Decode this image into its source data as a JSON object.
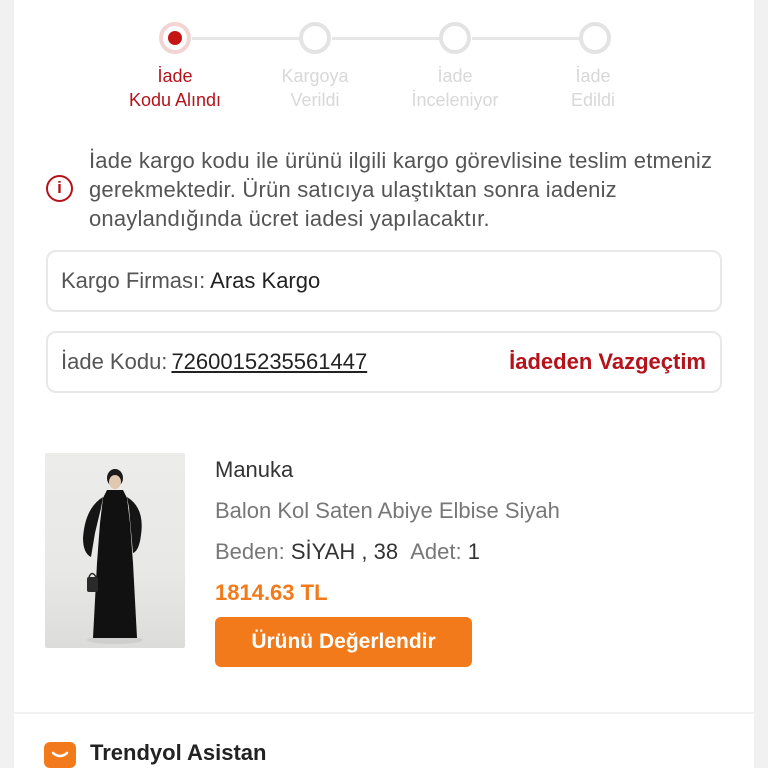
{
  "stepper": {
    "steps": [
      {
        "line1": "İade",
        "line2": "Kodu Alındı",
        "active": true
      },
      {
        "line1": "Kargoya",
        "line2": "Verildi",
        "active": false
      },
      {
        "line1": "İade",
        "line2": "İnceleniyor",
        "active": false
      },
      {
        "line1": "İade",
        "line2": "Edildi",
        "active": false
      }
    ]
  },
  "info": {
    "icon": "info-icon",
    "text": "İade kargo kodu ile ürünü ilgili kargo görevlisine teslim etmeniz gerekmektedir. Ürün satıcıya ulaştıktan sonra iadeniz onaylandığında ücret iadesi yapılacaktır."
  },
  "shipping": {
    "label": "Kargo Firması:",
    "value": "Aras Kargo"
  },
  "return_code": {
    "label": "İade Kodu:",
    "value": "7260015235561447",
    "cancel_label": "İadeden Vazgeçtim"
  },
  "product": {
    "brand": "Manuka",
    "name": "Balon Kol Saten Abiye Elbise Siyah",
    "size_label": "Beden:",
    "size_value": "SİYAH , 38",
    "qty_label": "Adet:",
    "qty_value": "1",
    "price": "1814.63 TL",
    "rate_button": "Ürünü Değerlendir"
  },
  "assistant": {
    "title": "Trendyol Asistan"
  },
  "colors": {
    "accent": "#f27a1a",
    "danger": "#b5121b"
  }
}
